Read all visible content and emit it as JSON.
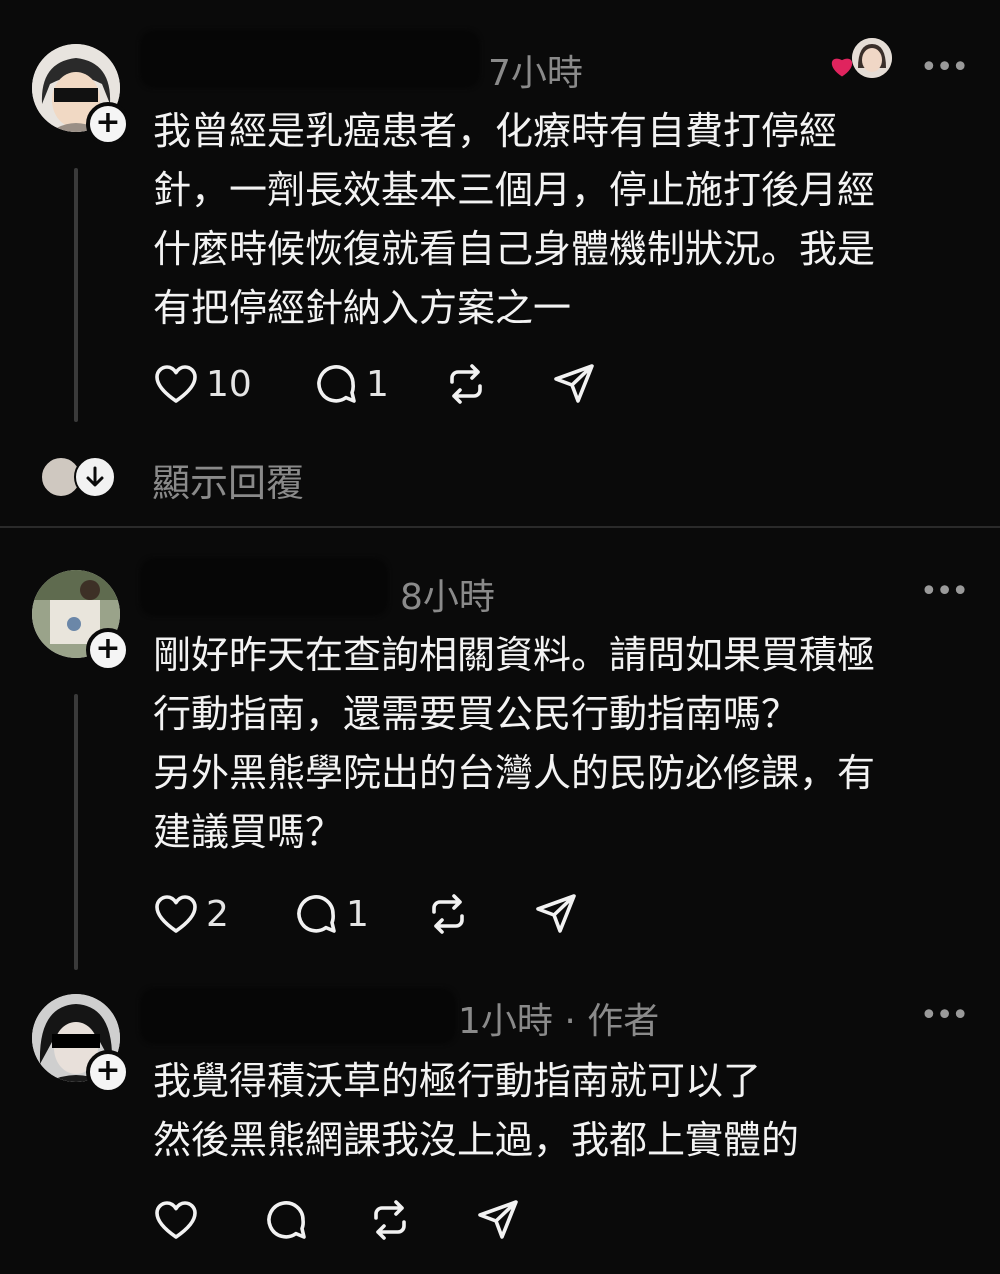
{
  "posts": [
    {
      "time": "7小時",
      "text": "我曾經是乳癌患者，化療時有自費打停經\n針，一劑長效基本三個月，停止施打後月經\n什麼時候恢復就看自己身體機制狀況。我是\n有把停經針納入方案之一",
      "likes": "10",
      "replies": "1"
    },
    {
      "time": "8小時",
      "text": "剛好昨天在查詢相關資料。請問如果買積極\n行動指南，還需要買公民行動指南嗎？\n另外黑熊學院出的台灣人的民防必修課，有\n建議買嗎？",
      "likes": "2",
      "replies": "1"
    },
    {
      "time": "1小時",
      "author_tag": "作者",
      "separator": "·",
      "text": "我覺得積沃草的極行動指南就可以了\n然後黑熊網課我沒上過，我都上實體的"
    }
  ],
  "show_replies_label": "顯示回覆",
  "more_label": "•••",
  "follow_label": "+",
  "colors": {
    "background": "#0a0a0a",
    "text": "#f3f3f3",
    "muted": "#8a8a8a",
    "like_heart": "#e0245e"
  },
  "icons": [
    "heart-icon",
    "comment-icon",
    "repost-icon",
    "share-icon",
    "more-icon",
    "plus-icon",
    "chevron-down-icon"
  ]
}
